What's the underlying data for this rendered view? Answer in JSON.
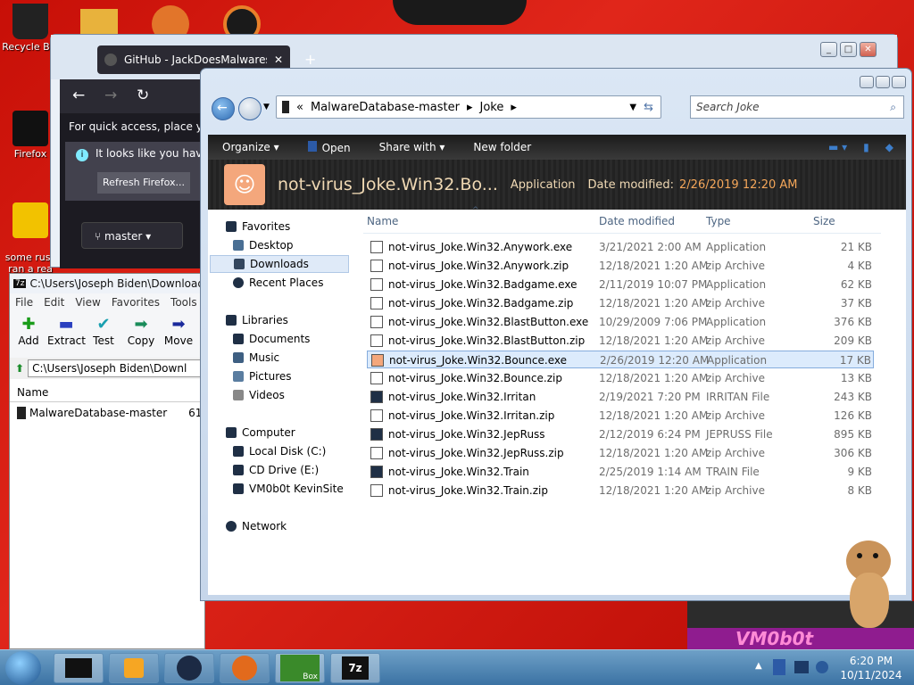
{
  "desktop": {
    "icons": [
      {
        "label": "Recycle Bin",
        "icon": "recycle-bin-icon"
      },
      {
        "label": "Firefox",
        "icon": "firefox-icon"
      },
      {
        "label": "some russ\nran a rea",
        "icon": "document-icon"
      }
    ]
  },
  "firefox": {
    "tab_title": "GitHub - JackDoesMalwares/M",
    "quick_access": "For quick access, place your",
    "notice": "It looks like you haven",
    "refresh_button": "Refresh Firefox...",
    "branch": "master"
  },
  "sevenzip": {
    "title": "C:\\Users\\Joseph Biden\\Downloads\\M",
    "menu": [
      "File",
      "Edit",
      "View",
      "Favorites",
      "Tools"
    ],
    "tools": [
      {
        "label": "Add",
        "icon": "add-icon"
      },
      {
        "label": "Extract",
        "icon": "extract-icon"
      },
      {
        "label": "Test",
        "icon": "test-icon"
      },
      {
        "label": "Copy",
        "icon": "copy-icon"
      },
      {
        "label": "Move",
        "icon": "move-icon"
      }
    ],
    "address": "C:\\Users\\Joseph Biden\\Downl",
    "column_name": "Name",
    "row_name": "MalwareDatabase-master",
    "row_extra": "61"
  },
  "explorer": {
    "breadcrumb": [
      "MalwareDatabase-master",
      "Joke"
    ],
    "search_placeholder": "Search Joke",
    "toolbar": {
      "organize": "Organize",
      "open": "Open",
      "share": "Share with",
      "new_folder": "New folder"
    },
    "detail": {
      "name": "not-virus_Joke.Win32.Bo...",
      "type": "Application",
      "date_label": "Date modified:",
      "date_value": "2/26/2019 12:20 AM"
    },
    "nav": {
      "favorites": "Favorites",
      "fav_items": [
        "Desktop",
        "Downloads",
        "Recent Places"
      ],
      "libraries": "Libraries",
      "lib_items": [
        "Documents",
        "Music",
        "Pictures",
        "Videos"
      ],
      "computer": "Computer",
      "comp_items": [
        "Local Disk (C:)",
        "CD Drive (E:)",
        "VM0b0t KevinSite"
      ],
      "network": "Network"
    },
    "columns": {
      "name": "Name",
      "date": "Date modified",
      "type": "Type",
      "size": "Size"
    },
    "files": [
      {
        "name": "not-virus_Joke.Win32.Anywork.exe",
        "date": "3/21/2021 2:00 AM",
        "type": "Application",
        "size": "21 KB"
      },
      {
        "name": "not-virus_Joke.Win32.Anywork.zip",
        "date": "12/18/2021 1:20 AM",
        "type": "zip Archive",
        "size": "4 KB"
      },
      {
        "name": "not-virus_Joke.Win32.Badgame.exe",
        "date": "2/11/2019 10:07 PM",
        "type": "Application",
        "size": "62 KB"
      },
      {
        "name": "not-virus_Joke.Win32.Badgame.zip",
        "date": "12/18/2021 1:20 AM",
        "type": "zip Archive",
        "size": "37 KB"
      },
      {
        "name": "not-virus_Joke.Win32.BlastButton.exe",
        "date": "10/29/2009 7:06 PM",
        "type": "Application",
        "size": "376 KB"
      },
      {
        "name": "not-virus_Joke.Win32.BlastButton.zip",
        "date": "12/18/2021 1:20 AM",
        "type": "zip Archive",
        "size": "209 KB"
      },
      {
        "name": "not-virus_Joke.Win32.Bounce.exe",
        "date": "2/26/2019 12:20 AM",
        "type": "Application",
        "size": "17 KB"
      },
      {
        "name": "not-virus_Joke.Win32.Bounce.zip",
        "date": "12/18/2021 1:20 AM",
        "type": "zip Archive",
        "size": "13 KB"
      },
      {
        "name": "not-virus_Joke.Win32.Irritan",
        "date": "2/19/2021 7:20 PM",
        "type": "IRRITAN File",
        "size": "243 KB"
      },
      {
        "name": "not-virus_Joke.Win32.Irritan.zip",
        "date": "12/18/2021 1:20 AM",
        "type": "zip Archive",
        "size": "126 KB"
      },
      {
        "name": "not-virus_Joke.Win32.JepRuss",
        "date": "2/12/2019 6:24 PM",
        "type": "JEPRUSS File",
        "size": "895 KB"
      },
      {
        "name": "not-virus_Joke.Win32.JepRuss.zip",
        "date": "12/18/2021 1:20 AM",
        "type": "zip Archive",
        "size": "306 KB"
      },
      {
        "name": "not-virus_Joke.Win32.Train",
        "date": "2/25/2019 1:14 AM",
        "type": "TRAIN File",
        "size": "9 KB"
      },
      {
        "name": "not-virus_Joke.Win32.Train.zip",
        "date": "12/18/2021 1:20 AM",
        "type": "zip Archive",
        "size": "8 KB"
      }
    ]
  },
  "bgwindow": {
    "text": "VM0b0t"
  },
  "taskbar": {
    "time": "6:20 PM",
    "date": "10/11/2024",
    "box_label": "Box"
  }
}
